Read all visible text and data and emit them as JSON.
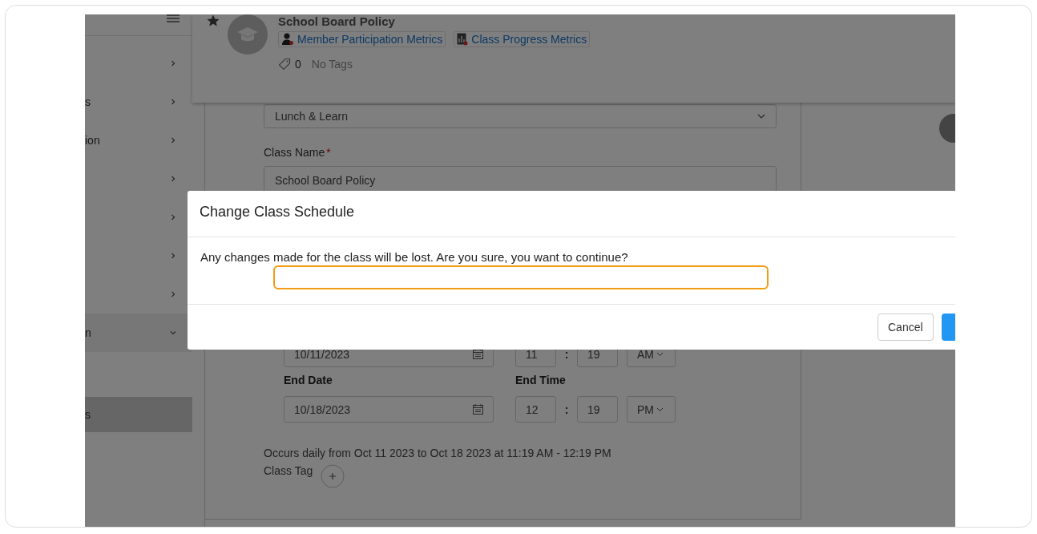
{
  "sidebar": {
    "items": [
      {
        "expanded": false
      },
      {
        "label": "s",
        "expanded": false
      },
      {
        "label": "ion",
        "expanded": false
      },
      {
        "expanded": false
      },
      {
        "expanded": false
      },
      {
        "expanded": false
      },
      {
        "expanded": false
      },
      {
        "label": "n",
        "expanded": true,
        "children": [
          {
            "label": "s",
            "selected": true
          }
        ]
      }
    ]
  },
  "header": {
    "title": "School Board Policy",
    "links": [
      {
        "kind": "member",
        "label": "Member Participation Metrics"
      },
      {
        "kind": "progress",
        "label": "Class Progress Metrics"
      }
    ],
    "tag_count": "0",
    "tags_text": "No Tags"
  },
  "form": {
    "class_type": "Lunch & Learn",
    "class_name_label": "Class Name",
    "required_mark": "*",
    "class_name": "School Board Policy",
    "start": {
      "date": "10/11/2023",
      "hour": "11",
      "separator": ":",
      "minute": "19",
      "period": "AM"
    },
    "end_date_label": "End Date",
    "end_time_label": "End Time",
    "end": {
      "date": "10/18/2023",
      "hour": "12",
      "separator": ":",
      "minute": "19",
      "period": "PM"
    },
    "summary": "Occurs daily from Oct 11 2023 to Oct 18 2023 at 11:19 AM - 12:19 PM",
    "tag_label": "Class Tag"
  },
  "dialog": {
    "title": "Change Class Schedule",
    "message": "Any changes made for the class will be lost. Are you sure, you want to continue?",
    "cancel": "Cancel"
  }
}
